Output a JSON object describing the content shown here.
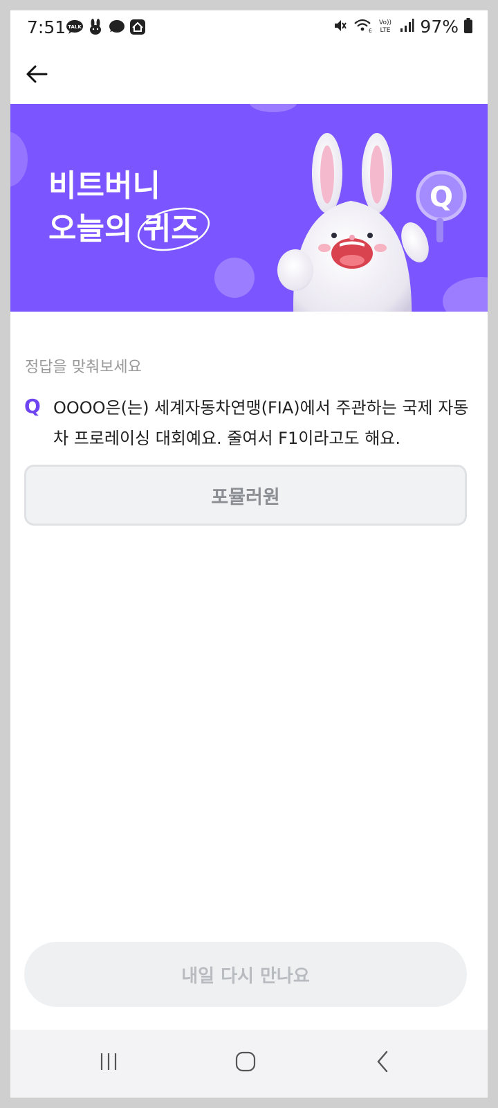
{
  "status": {
    "time": "7:51",
    "battery": "97%",
    "left_icons": [
      "talk-icon",
      "rabbit-icon",
      "chat-bubble-icon",
      "home-app-icon"
    ],
    "right_icons": [
      "mute-icon",
      "wifi-icon",
      "volte-icon",
      "signal-icon",
      "battery-icon"
    ]
  },
  "header": {
    "back_icon": "back-arrow-icon"
  },
  "banner": {
    "title_line1": "비트버니",
    "title_line2_prefix": "오늘의 ",
    "title_line2_highlight": "퀴즈",
    "bg_color": "#7b55ff"
  },
  "quiz": {
    "instruction": "정답을 맞춰보세요",
    "q_label": "Q",
    "question": "OOOO은(는) 세계자동차연맹(FIA)에서 주관하는 국제 자동차 프로레이싱 대회예요. 줄여서 F1이라고도 해요.",
    "answer": "포뮬러원"
  },
  "footer": {
    "cta_label": "내일 다시 만나요"
  },
  "navbar": {
    "icons": [
      "recent-apps-icon",
      "home-icon",
      "back-icon"
    ]
  },
  "colors": {
    "accent": "#6e45f0",
    "banner": "#7b55ff"
  }
}
